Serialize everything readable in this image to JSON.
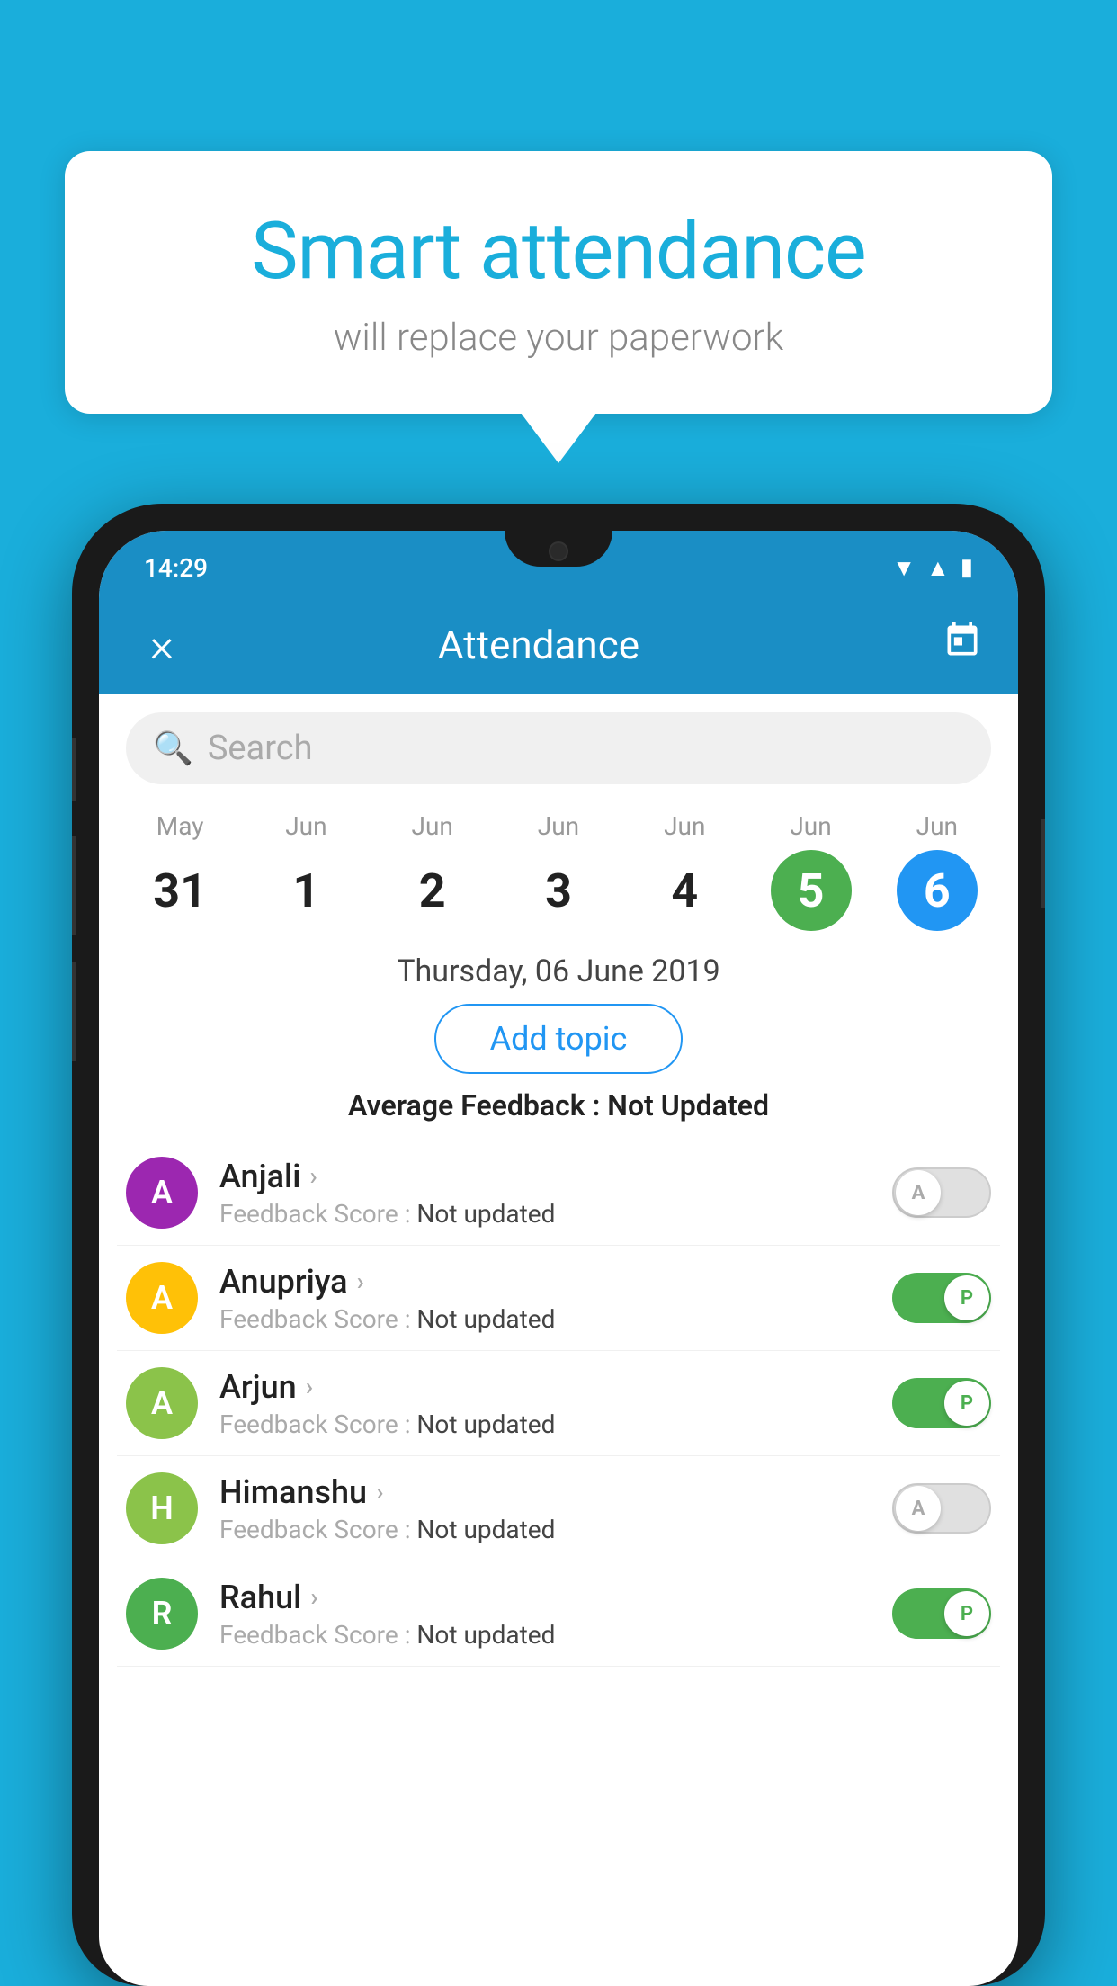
{
  "background_color": "#1AAEDB",
  "bubble": {
    "title": "Smart attendance",
    "subtitle": "will replace your paperwork"
  },
  "phone": {
    "status_bar": {
      "time": "14:29",
      "icons": [
        "wifi",
        "signal",
        "battery"
      ]
    },
    "header": {
      "title": "Attendance",
      "close_label": "×",
      "calendar_icon": "📅"
    },
    "search": {
      "placeholder": "Search"
    },
    "calendar": {
      "columns": [
        {
          "month": "May",
          "day": "31",
          "style": "normal"
        },
        {
          "month": "Jun",
          "day": "1",
          "style": "normal"
        },
        {
          "month": "Jun",
          "day": "2",
          "style": "normal"
        },
        {
          "month": "Jun",
          "day": "3",
          "style": "normal"
        },
        {
          "month": "Jun",
          "day": "4",
          "style": "normal"
        },
        {
          "month": "Jun",
          "day": "5",
          "style": "selected-green"
        },
        {
          "month": "Jun",
          "day": "6",
          "style": "selected-blue"
        }
      ]
    },
    "selected_date": "Thursday, 06 June 2019",
    "add_topic_label": "Add topic",
    "avg_feedback_label": "Average Feedback :",
    "avg_feedback_value": "Not Updated",
    "students": [
      {
        "name": "Anjali",
        "initial": "A",
        "avatar_color": "#9C27B0",
        "feedback_label": "Feedback Score :",
        "feedback_value": "Not updated",
        "toggle": "inactive",
        "toggle_letter": "A"
      },
      {
        "name": "Anupriya",
        "initial": "A",
        "avatar_color": "#FFC107",
        "feedback_label": "Feedback Score :",
        "feedback_value": "Not updated",
        "toggle": "active-present",
        "toggle_letter": "P"
      },
      {
        "name": "Arjun",
        "initial": "A",
        "avatar_color": "#8BC34A",
        "feedback_label": "Feedback Score :",
        "feedback_value": "Not updated",
        "toggle": "active-present",
        "toggle_letter": "P"
      },
      {
        "name": "Himanshu",
        "initial": "H",
        "avatar_color": "#8BC34A",
        "feedback_label": "Feedback Score :",
        "feedback_value": "Not updated",
        "toggle": "inactive",
        "toggle_letter": "A"
      },
      {
        "name": "Rahul",
        "initial": "R",
        "avatar_color": "#4CAF50",
        "feedback_label": "Feedback Score :",
        "feedback_value": "Not updated",
        "toggle": "active-present",
        "toggle_letter": "P"
      }
    ]
  }
}
